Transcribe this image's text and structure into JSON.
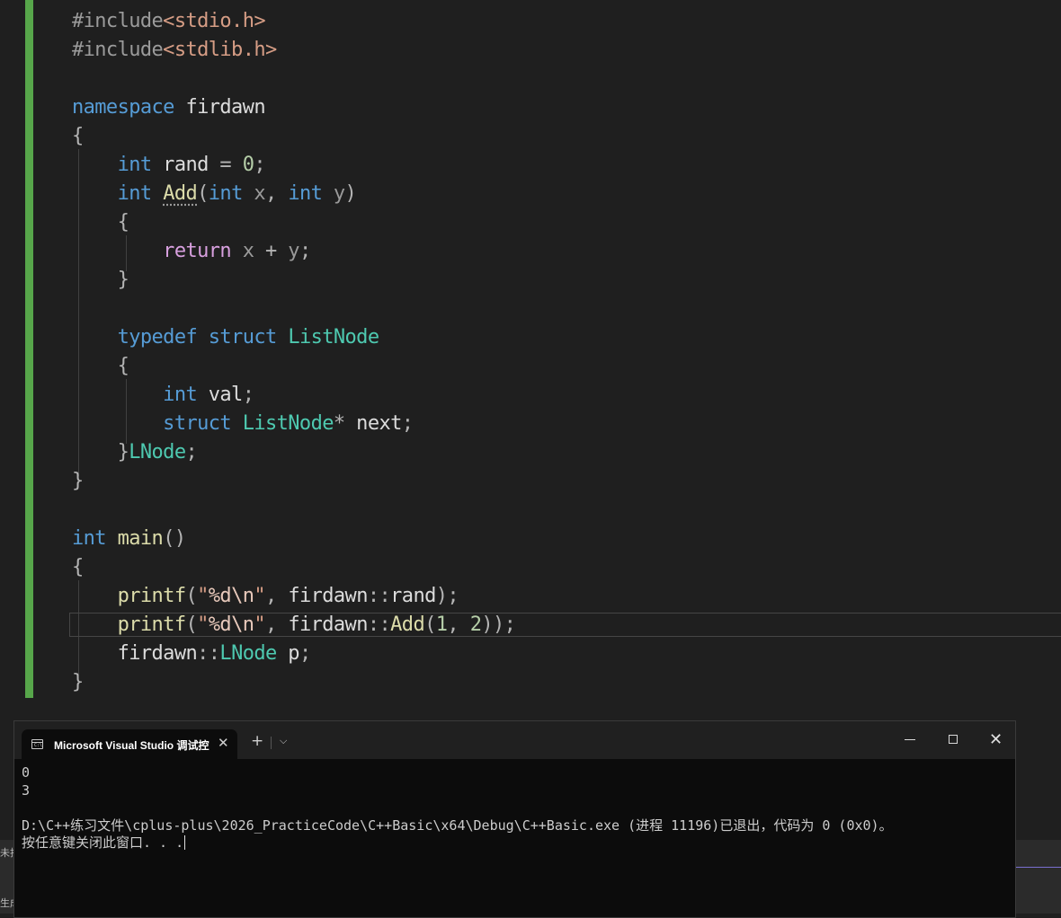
{
  "editor": {
    "lines": [
      [
        [
          "c-pp",
          "#include"
        ],
        [
          "c-inc",
          "<stdio.h>"
        ]
      ],
      [
        [
          "c-pp",
          "#include"
        ],
        [
          "c-inc",
          "<stdlib.h>"
        ]
      ],
      [],
      [
        [
          "c-kw",
          "namespace"
        ],
        [
          "c-id",
          " firdawn"
        ]
      ],
      [
        [
          "c-br",
          "{"
        ]
      ],
      [
        [
          "c-id",
          "    "
        ],
        [
          "c-kw",
          "int"
        ],
        [
          "c-id",
          " rand "
        ],
        [
          "c-pun",
          "="
        ],
        [
          "c-id",
          " "
        ],
        [
          "c-num",
          "0"
        ],
        [
          "c-pun",
          ";"
        ]
      ],
      [
        [
          "c-id",
          "    "
        ],
        [
          "c-kw",
          "int"
        ],
        [
          "c-id",
          " "
        ],
        [
          "c-fn squig",
          "Add"
        ],
        [
          "c-pun",
          "("
        ],
        [
          "c-kw",
          "int"
        ],
        [
          "c-par",
          " x"
        ],
        [
          "c-pun",
          ", "
        ],
        [
          "c-kw",
          "int"
        ],
        [
          "c-par",
          " y"
        ],
        [
          "c-pun",
          ")"
        ]
      ],
      [
        [
          "c-id",
          "    "
        ],
        [
          "c-br",
          "{"
        ]
      ],
      [
        [
          "c-id",
          "        "
        ],
        [
          "c-ctl",
          "return"
        ],
        [
          "c-par",
          " x "
        ],
        [
          "c-pun",
          "+"
        ],
        [
          "c-par",
          " y"
        ],
        [
          "c-pun",
          ";"
        ]
      ],
      [
        [
          "c-id",
          "    "
        ],
        [
          "c-br",
          "}"
        ]
      ],
      [],
      [
        [
          "c-id",
          "    "
        ],
        [
          "c-kw",
          "typedef"
        ],
        [
          "c-id",
          " "
        ],
        [
          "c-kw",
          "struct"
        ],
        [
          "c-id",
          " "
        ],
        [
          "c-ty",
          "ListNode"
        ]
      ],
      [
        [
          "c-id",
          "    "
        ],
        [
          "c-br",
          "{"
        ]
      ],
      [
        [
          "c-id",
          "        "
        ],
        [
          "c-kw",
          "int"
        ],
        [
          "c-id",
          " val"
        ],
        [
          "c-pun",
          ";"
        ]
      ],
      [
        [
          "c-id",
          "        "
        ],
        [
          "c-kw",
          "struct"
        ],
        [
          "c-id",
          " "
        ],
        [
          "c-ty",
          "ListNode"
        ],
        [
          "c-pun",
          "*"
        ],
        [
          "c-id",
          " next"
        ],
        [
          "c-pun",
          ";"
        ]
      ],
      [
        [
          "c-id",
          "    "
        ],
        [
          "c-br",
          "}"
        ],
        [
          "c-ty",
          "LNode"
        ],
        [
          "c-pun",
          ";"
        ]
      ],
      [
        [
          "c-br",
          "}"
        ]
      ],
      [],
      [
        [
          "c-kw",
          "int"
        ],
        [
          "c-id",
          " "
        ],
        [
          "c-fn",
          "main"
        ],
        [
          "c-pun",
          "()"
        ]
      ],
      [
        [
          "c-br",
          "{"
        ]
      ],
      [
        [
          "c-id",
          "    "
        ],
        [
          "c-fn",
          "printf"
        ],
        [
          "c-pun",
          "("
        ],
        [
          "c-str",
          "\""
        ],
        [
          "c-esc",
          "%d\\n"
        ],
        [
          "c-str",
          "\""
        ],
        [
          "c-pun",
          ", "
        ],
        [
          "c-id",
          "firdawn"
        ],
        [
          "c-pun",
          "::"
        ],
        [
          "c-id",
          "rand"
        ],
        [
          "c-pun",
          ");"
        ]
      ],
      [
        [
          "c-id",
          "    "
        ],
        [
          "c-fn",
          "printf"
        ],
        [
          "c-pun",
          "("
        ],
        [
          "c-str",
          "\""
        ],
        [
          "c-esc",
          "%d\\n"
        ],
        [
          "c-str",
          "\""
        ],
        [
          "c-pun",
          ", "
        ],
        [
          "c-id",
          "firdawn"
        ],
        [
          "c-pun",
          "::"
        ],
        [
          "c-fn",
          "Add"
        ],
        [
          "c-pun",
          "("
        ],
        [
          "c-num",
          "1"
        ],
        [
          "c-pun",
          ", "
        ],
        [
          "c-num",
          "2"
        ],
        [
          "c-pun",
          "));"
        ]
      ],
      [
        [
          "c-id",
          "    "
        ],
        [
          "c-id",
          "firdawn"
        ],
        [
          "c-pun",
          "::"
        ],
        [
          "c-ty",
          "LNode"
        ],
        [
          "c-id",
          " p"
        ],
        [
          "c-pun",
          ";"
        ]
      ],
      [
        [
          "c-br",
          "}"
        ]
      ]
    ]
  },
  "console": {
    "tab_title": "Microsoft Visual Studio 调试控",
    "tab_close": "✕",
    "new_tab": "+",
    "dropdown": "⌵",
    "close_glyph": "✕",
    "output": [
      "0",
      "3",
      "",
      "D:\\C++练习文件\\cplus-plus\\2026_PracticeCode\\C++Basic\\x64\\Debug\\C++Basic.exe (进程 11196)已退出，代码为 0 (0x0)。",
      "按任意键关闭此窗口. . ."
    ]
  },
  "side_strip": {
    "top_label": "未找",
    "bottom_label": "生成"
  }
}
